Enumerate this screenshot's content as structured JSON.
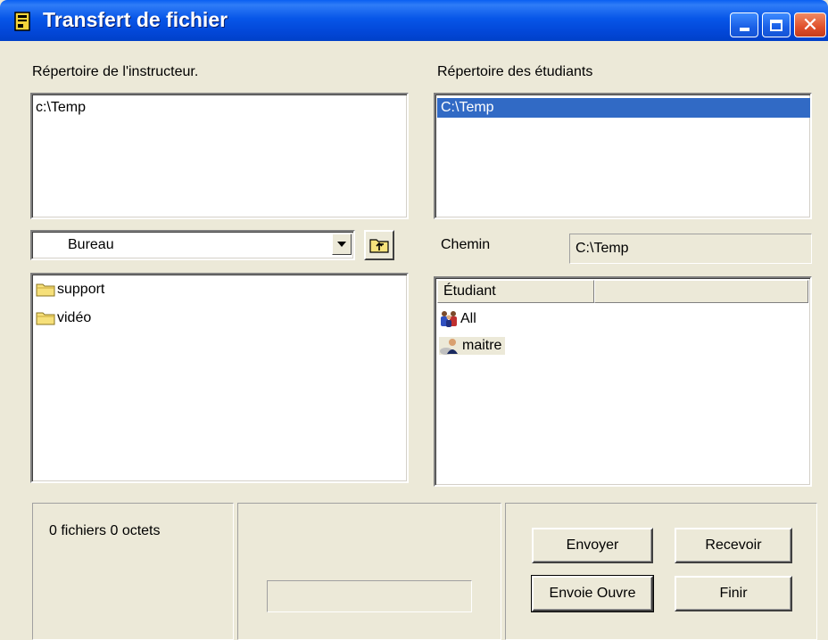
{
  "window": {
    "title": "Transfert de fichier"
  },
  "instructor": {
    "label": "Répertoire de l'instructeur.",
    "directories": [
      "c:\\Temp"
    ],
    "location": "Bureau",
    "files": [
      {
        "name": "support",
        "icon": "folder-icon"
      },
      {
        "name": "vidéo",
        "icon": "folder-icon"
      }
    ]
  },
  "students": {
    "label": "Répertoire des étudiants",
    "directories": [
      "C:\\Temp"
    ],
    "path_label": "Chemin",
    "path_value": "C:\\Temp",
    "column_header": "Étudiant",
    "rows": [
      {
        "name": "All",
        "icon": "group-icon"
      },
      {
        "name": "maitre",
        "icon": "user-icon",
        "highlighted": true
      }
    ]
  },
  "status": {
    "summary": "0 fichiers 0 octets"
  },
  "buttons": {
    "send": "Envoyer",
    "receive": "Recevoir",
    "send_open": "Envoie Ouvre",
    "finish": "Finir"
  },
  "colors": {
    "titlebar": "#0054e3",
    "selection": "#316ac5",
    "window_bg": "#ece9d8",
    "close_button": "#e0502a"
  }
}
